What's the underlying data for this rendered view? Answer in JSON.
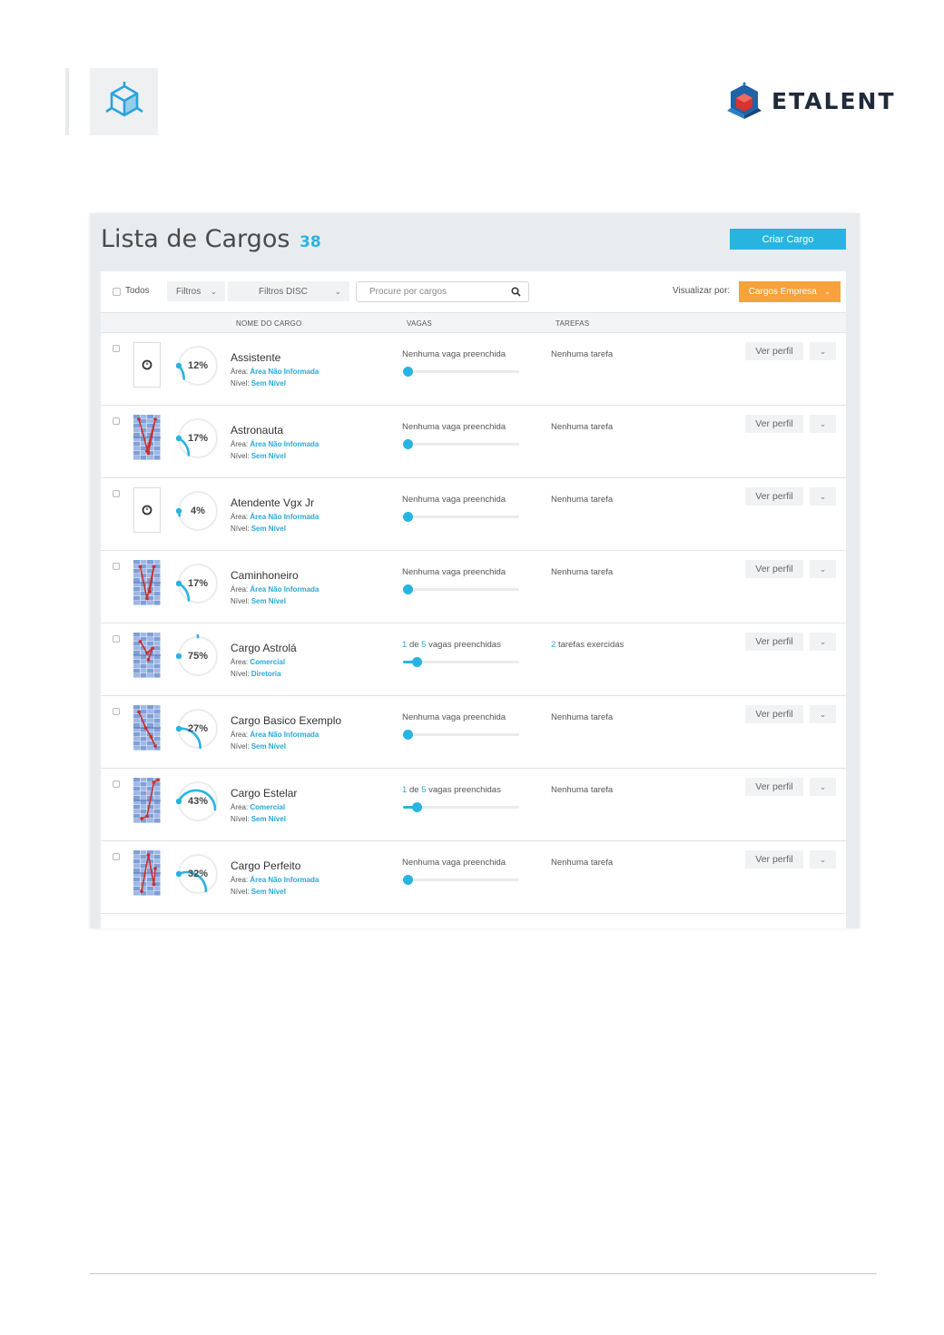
{
  "header": {
    "corner_logo_icon": "cube-icon",
    "brand": {
      "name": "ETALENT",
      "icon": "cube-logo-icon",
      "colors": {
        "blue": "#1f63a8",
        "red": "#d8332e",
        "navy": "#1f2a3a"
      }
    }
  },
  "screen": {
    "title": "Lista de Cargos",
    "count": "38",
    "create_button": "Criar Cargo",
    "toolbar": {
      "select_all": "Todos",
      "filters": "Filtros",
      "filters_disc": "Filtros DISC",
      "search_placeholder": "Procure por cargos",
      "view_by_label": "Visualizar por:",
      "view_by_value": "Cargos Empresa"
    },
    "columns": {
      "name": "NOME DO CARGO",
      "vagas": "VAGAS",
      "tarefas": "TAREFAS"
    },
    "labels": {
      "area": "Área:",
      "nivel": "Nível:",
      "ver_perfil": "Ver perfil",
      "vagas_de": "de",
      "vagas_suffix": "vagas preenchidas"
    },
    "accent_color": "#28b4e0",
    "orange_color": "#f7a23a",
    "rows": [
      {
        "name": "Assistente",
        "percent": "12%",
        "progress": 0.12,
        "thumb": "clock-icon",
        "area": "Área Não Informada",
        "nivel": "Sem Nível",
        "vagas": "Nenhuma vaga preenchida",
        "vagas_fill": 0,
        "tarefas": "Nenhuma tarefa"
      },
      {
        "name": "Astronauta",
        "percent": "17%",
        "progress": 0.17,
        "thumb": "disc-graph-icon",
        "area": "Área Não Informada",
        "nivel": "Sem Nível",
        "vagas": "Nenhuma vaga preenchida",
        "vagas_fill": 0,
        "tarefas": "Nenhuma tarefa"
      },
      {
        "name": "Atendente Vgx Jr",
        "percent": "4%",
        "progress": 0.04,
        "thumb": "clock-icon",
        "area": "Área Não Informada",
        "nivel": "Sem Nível",
        "vagas": "Nenhuma vaga preenchida",
        "vagas_fill": 0,
        "tarefas": "Nenhuma tarefa"
      },
      {
        "name": "Caminhoneiro",
        "percent": "17%",
        "progress": 0.17,
        "thumb": "disc-graph-icon",
        "area": "Área Não Informada",
        "nivel": "Sem Nível",
        "vagas": "Nenhuma vaga preenchida",
        "vagas_fill": 0,
        "tarefas": "Nenhuma tarefa"
      },
      {
        "name": "Cargo Astrolá",
        "percent": "75%",
        "progress": 0.75,
        "thumb": "disc-graph-icon",
        "area": "Comercial",
        "nivel": "Diretoria",
        "vagas_filled": "1",
        "vagas_total": "5",
        "vagas_fill": 0.2,
        "tarefas_count": "2",
        "tarefas_text": "tarefas exercidas"
      },
      {
        "name": "Cargo Basico Exemplo",
        "percent": "27%",
        "progress": 0.27,
        "thumb": "disc-graph-icon",
        "area": "Área Não Informada",
        "nivel": "Sem Nível",
        "vagas": "Nenhuma vaga preenchida",
        "vagas_fill": 0,
        "tarefas": "Nenhuma tarefa"
      },
      {
        "name": "Cargo Estelar",
        "percent": "43%",
        "progress": 0.43,
        "thumb": "disc-graph-icon",
        "area": "Comercial",
        "nivel": "Sem Nível",
        "vagas_filled": "1",
        "vagas_total": "5",
        "vagas_fill": 0.2,
        "tarefas": "Nenhuma tarefa"
      },
      {
        "name": "Cargo Perfeito",
        "percent": "32%",
        "progress": 0.32,
        "thumb": "disc-graph-icon",
        "area": "Área Não Informada",
        "nivel": "Sem Nível",
        "vagas": "Nenhuma vaga preenchida",
        "vagas_fill": 0,
        "tarefas": "Nenhuma tarefa"
      }
    ]
  }
}
